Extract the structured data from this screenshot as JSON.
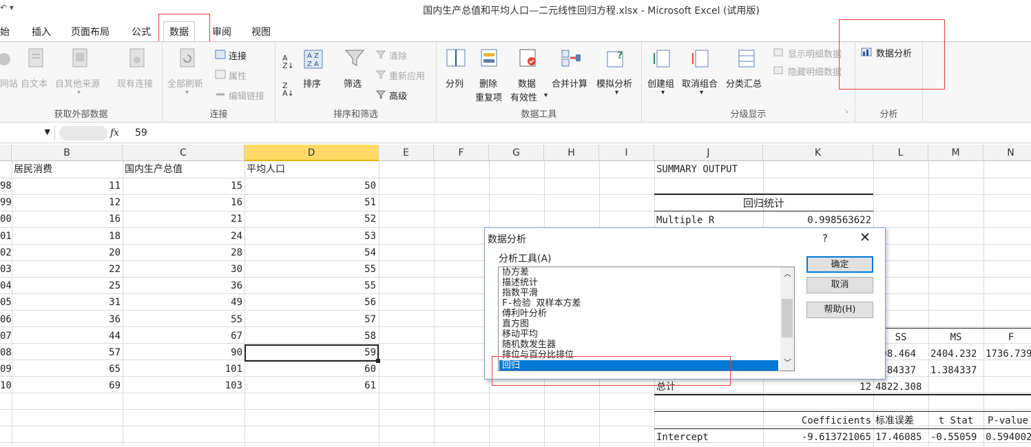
{
  "window": {
    "title": "国内生产总值和平均人口—二元线性回归方程.xlsx - Microsoft Excel (试用版)",
    "qat": "↶ ▾"
  },
  "tabs": [
    "始",
    "插入",
    "页面布局",
    "公式",
    "数据",
    "审阅",
    "视图"
  ],
  "ribbon": {
    "external": {
      "label": "获取外部数据",
      "items": [
        "网站",
        "自文本",
        "自其他来源",
        "现有连接"
      ]
    },
    "connections": {
      "label": "连接",
      "refresh": "全部刷新",
      "items": [
        "连接",
        "属性",
        "编辑链接"
      ]
    },
    "sort": {
      "label": "排序和筛选",
      "sort": "排序",
      "filter": "筛选",
      "items": [
        "清除",
        "重新应用",
        "高级"
      ]
    },
    "tools": {
      "label": "数据工具",
      "split": "分列",
      "dedupe1": "删除",
      "dedupe2": "重复项",
      "valid1": "数据",
      "valid2": "有效性",
      "consol": "合并计算",
      "whatif": "模拟分析"
    },
    "outline": {
      "label": "分级显示",
      "group": "创建组",
      "ungroup": "取消组合",
      "subtotal": "分类汇总",
      "items": [
        "显示明细数据",
        "隐藏明细数据"
      ]
    },
    "analysis": {
      "label": "分析",
      "btn": "数据分析"
    }
  },
  "formula": {
    "fx": "fx",
    "value": "59"
  },
  "columns": [
    "B",
    "C",
    "D",
    "E",
    "F",
    "G",
    "H",
    "I",
    "J",
    "K",
    "L",
    "M",
    "N"
  ],
  "headers": {
    "b": "居民消费",
    "c": "国内生产总值",
    "d": "平均人口"
  },
  "rows": [
    {
      "a": "98",
      "b": "11",
      "c": "15",
      "d": "50"
    },
    {
      "a": "99",
      "b": "12",
      "c": "16",
      "d": "51"
    },
    {
      "a": "00",
      "b": "16",
      "c": "21",
      "d": "52"
    },
    {
      "a": "01",
      "b": "18",
      "c": "24",
      "d": "53"
    },
    {
      "a": "02",
      "b": "20",
      "c": "28",
      "d": "54"
    },
    {
      "a": "03",
      "b": "22",
      "c": "30",
      "d": "55"
    },
    {
      "a": "04",
      "b": "25",
      "c": "36",
      "d": "55"
    },
    {
      "a": "05",
      "b": "31",
      "c": "49",
      "d": "56"
    },
    {
      "a": "06",
      "b": "36",
      "c": "55",
      "d": "57"
    },
    {
      "a": "07",
      "b": "44",
      "c": "67",
      "d": "58"
    },
    {
      "a": "08",
      "b": "57",
      "c": "90",
      "d": "59"
    },
    {
      "a": "09",
      "b": "65",
      "c": "101",
      "d": "60"
    },
    {
      "a": "10",
      "b": "69",
      "c": "103",
      "d": "61"
    }
  ],
  "summary": {
    "title": "SUMMARY OUTPUT",
    "reg_stats": "回归统计",
    "mult_r_label": "Multiple R",
    "mult_r": "0.998563622",
    "anova_ss": "SS",
    "anova_ms": "MS",
    "anova_f": "F",
    "r1_l": "308.464",
    "r1_m": "2404.232",
    "r1_n": "1736.739",
    "r2_l": "3.84337",
    "r2_m": "1.384337",
    "total_label": "总计",
    "total_k": "12",
    "total_l": "4822.308",
    "coef": "Coefficients",
    "stderr": "标准误差",
    "tstat": "t Stat",
    "pval": "P-value",
    "int_label": "Intercept",
    "int_k": "-9.613721065",
    "int_l": "17.46085",
    "int_m": "-0.55059",
    "int_n": "0.594002"
  },
  "dialog": {
    "title": "数据分析",
    "help": "?",
    "close": "✕",
    "list_label": "分析工具(A)",
    "items": [
      "协方差",
      "描述统计",
      "指数平滑",
      "F-检验 双样本方差",
      "傅利叶分析",
      "直方图",
      "移动平均",
      "随机数发生器",
      "排位与百分比排位",
      "回归"
    ],
    "ok": "确定",
    "cancel": "取消",
    "helpbtn": "帮助(H)"
  }
}
